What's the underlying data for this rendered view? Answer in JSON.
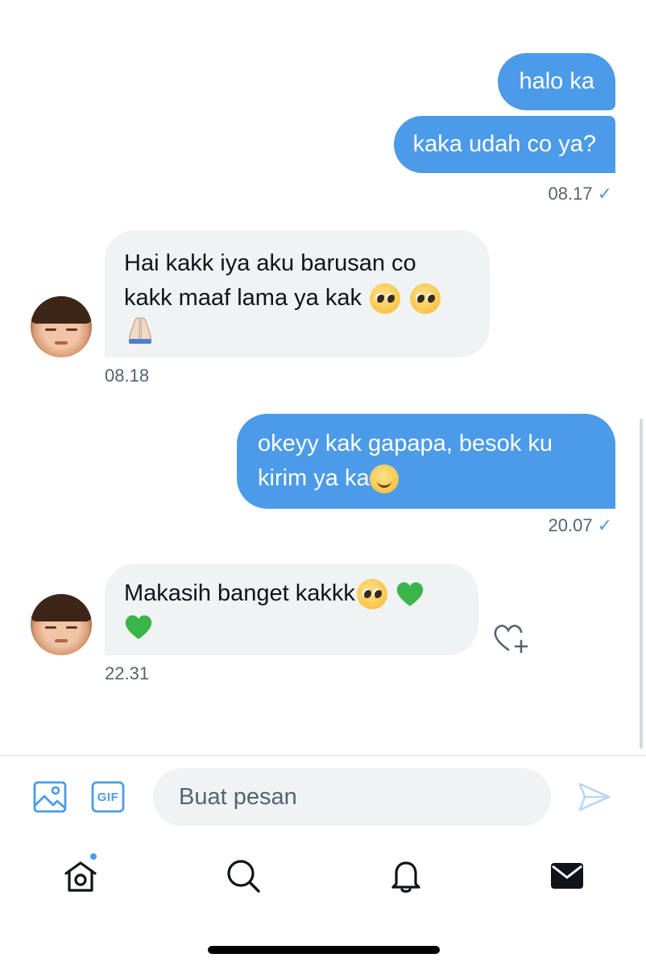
{
  "conversation": {
    "messages": [
      {
        "id": "m1",
        "direction": "outgoing",
        "text": "halo ka"
      },
      {
        "id": "m2",
        "direction": "outgoing",
        "text": "kaka udah co ya?"
      },
      {
        "id": "m3",
        "direction": "incoming",
        "text_line1": "Hai kakk iya aku barusan co",
        "text_line2": "kakk maaf lama ya kak",
        "emojis": [
          "pleading-face",
          "pleading-face",
          "folded-hands"
        ]
      },
      {
        "id": "m4",
        "direction": "outgoing",
        "text_line1": "okeyy kak gapapa, besok ku",
        "text_line2": "kirim ya ka",
        "emojis": [
          "smiling-face"
        ]
      },
      {
        "id": "m5",
        "direction": "incoming",
        "text": "Makasih banget kakkk",
        "emojis": [
          "pleading-face",
          "green-heart",
          "green-heart"
        ]
      }
    ],
    "timestamps": {
      "t1": "08.17",
      "t2": "08.18",
      "t3": "20.07",
      "t4": "22.31"
    },
    "read_mark": "✓"
  },
  "composer": {
    "placeholder": "Buat pesan",
    "gif_label": "GIF",
    "icons": [
      "image-icon",
      "gif-icon",
      "send-icon"
    ]
  },
  "tabbar": {
    "icons": [
      "home-icon",
      "search-icon",
      "bell-icon",
      "mail-icon"
    ],
    "home_has_notification": true
  },
  "colors": {
    "accent": "#4c9be8",
    "incoming_bubble": "#eff3f4",
    "muted_text": "#536471",
    "green_heart": "#3bb44a"
  }
}
